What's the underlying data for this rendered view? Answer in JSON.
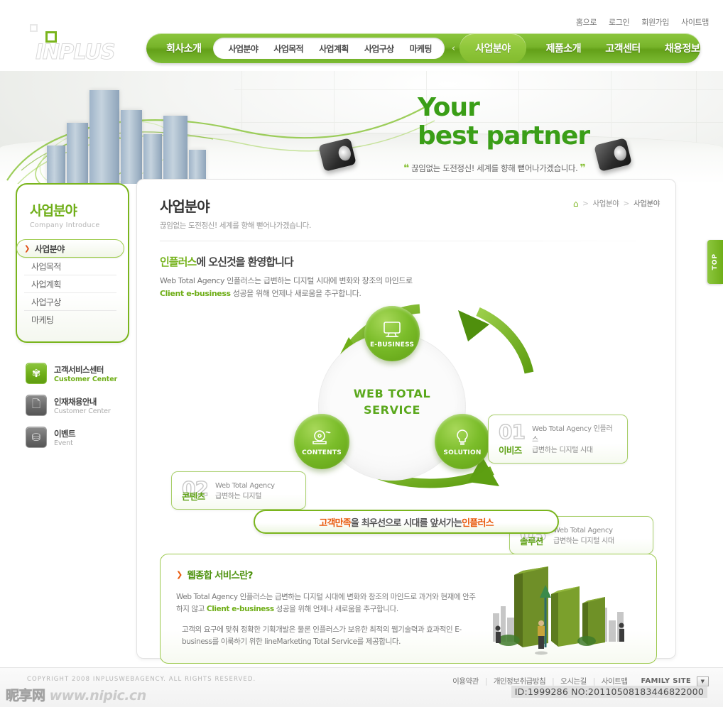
{
  "header": {
    "logo_text": "INPLUS",
    "utility_links": [
      "홈으로",
      "로그인",
      "회원가입",
      "사이트맵"
    ],
    "nav_first": "회사소개",
    "subnav": [
      "사업분야",
      "사업목적",
      "사업계획",
      "사업구상",
      "마케팅"
    ],
    "nav_arrow": "‹",
    "nav_active": "사업분야",
    "nav_right": [
      "제품소개",
      "고객센터",
      "채용정보"
    ]
  },
  "hero": {
    "title_line1": "Your",
    "title_line2": "best partner",
    "quote_open": "❝",
    "subtitle": "끊임없는 도전정신! 세계를 향해 뻗어나가겠습니다.",
    "quote_close": "❞"
  },
  "sidebar": {
    "title": "사업분야",
    "subtitle": "Company Introduce",
    "items": [
      {
        "label": "사업분야",
        "active": true
      },
      {
        "label": "사업목적",
        "active": false
      },
      {
        "label": "사업계획",
        "active": false
      },
      {
        "label": "사업구상",
        "active": false
      },
      {
        "label": "마케팅",
        "active": false
      }
    ],
    "banners": [
      {
        "title": "고객서비스센터",
        "sub": "Customer Center",
        "icon": "flower-icon",
        "glyph": "✾",
        "green": true
      },
      {
        "title": "인재채용안내",
        "sub": "Customer Center",
        "icon": "document-icon",
        "glyph": "🗋",
        "green": false
      },
      {
        "title": "이벤트",
        "sub": "Event",
        "icon": "gift-icon",
        "glyph": "⛁",
        "green": false
      }
    ]
  },
  "page": {
    "title": "사업분야",
    "description": "끊임없는 도전정신! 세계를 향해 뻗어나가겠습니다.",
    "breadcrumb": {
      "home_icon": "home-icon",
      "items": [
        "사업분야",
        "사업분야"
      ],
      "separator": ">"
    },
    "welcome_title_highlight": "인플러스",
    "welcome_title_rest": "에 오신것을 환영합니다",
    "welcome_line1": "Web Total Agency 인플러스는 급변하는 디지털 시대에 변화와 창조의 마인드로",
    "welcome_line2_strong": "Client e-business",
    "welcome_line2_rest": " 성공을 위해 언제나 새로움을 추구합니다."
  },
  "diagram": {
    "center_line1": "WEB TOTAL",
    "center_line2": "SERVICE",
    "nodes": [
      {
        "label": "E-BUSINESS",
        "icon": "monitor-icon"
      },
      {
        "label": "CONTENTS",
        "icon": "disc-icon"
      },
      {
        "label": "SOLUTION",
        "icon": "lightbulb-icon"
      }
    ],
    "callouts": [
      {
        "num": "01",
        "line1": "Web Total Agency 인플러스",
        "line2": "급변하는 디지털 시대",
        "label": "이비즈"
      },
      {
        "num": "02",
        "line1": "Web Total Agency",
        "line2": "급변하는 디지털",
        "label": "콘텐츠"
      },
      {
        "num": "03",
        "line1": "Web Total Agency",
        "line2": "급변하는 디지털 시대",
        "label": "솔루션"
      }
    ]
  },
  "slogan": {
    "part1": "고객만족",
    "part2": "을 최우선으로 시대를 앞서가는 ",
    "part3": "인플러스"
  },
  "infobox": {
    "arrow": "❯",
    "title": "웹종합 서비스란?",
    "p1_a": "Web Total Agency 인플러스는 급변하는 디지털 시대에 변화와 창조의 마인드로 과거와 현재에 안주하지 않고 ",
    "p1_b": "Client e-business",
    "p1_c": " 성공을 위해 언제나 새로움을 추구합니다.",
    "p2": "고객의 요구에 맞춰 정확한 기획개발은 물론 인플러스가 보유한 최적의 웹기술력과 효과적인 E-business를 이룩하기 위한 lineMarketing Total Service를 제공합니다."
  },
  "top_button": {
    "label": "TOP",
    "arrow": "‹"
  },
  "footer": {
    "copyright": "COPYRIGHT 2008 INPLUSWEBAGENCY. ALL RIGHTS RESERVED.",
    "links": [
      "이용약관",
      "개인정보취급방침",
      "오시는길",
      "사이트맵"
    ],
    "separator": "|",
    "family_site": "FAMILY SITE",
    "family_arrow": "▼",
    "watermark_cjk": "昵享网",
    "watermark_url": "www.nipic.cn",
    "id_overlay": "ID:1999286 NO:20110508183446822000"
  },
  "colors": {
    "brand_green": "#7ab51d",
    "light_green": "#8cc63e",
    "accent_orange": "#e8590c",
    "text_gray": "#777777"
  }
}
